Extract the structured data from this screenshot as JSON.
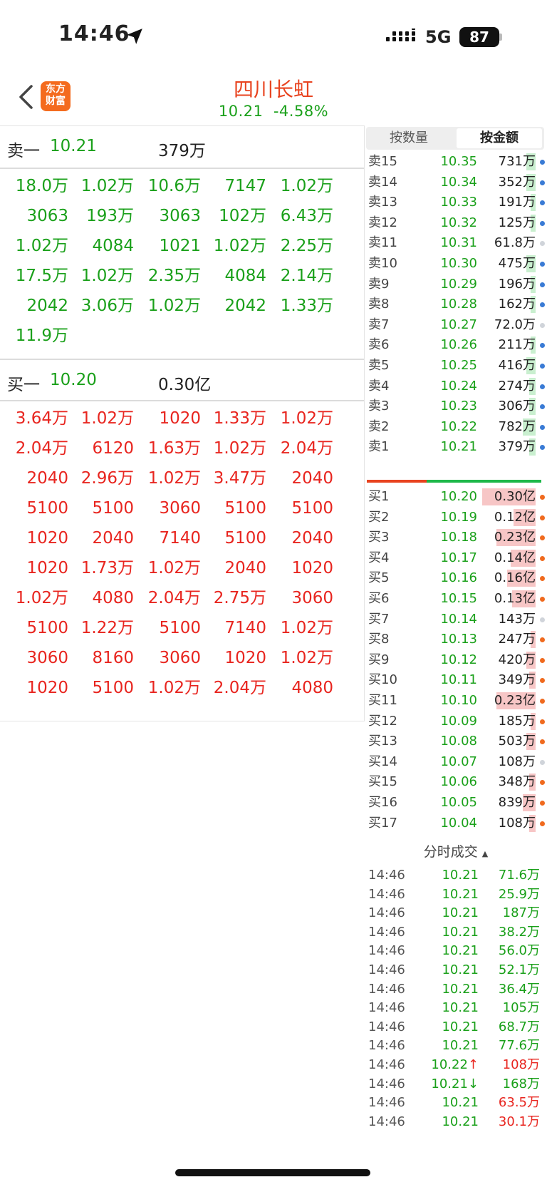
{
  "status": {
    "time": "14:46",
    "network": "5G",
    "battery": "87"
  },
  "header": {
    "logo_line1": "东方",
    "logo_line2": "财富",
    "title": "四川长虹",
    "price": "10.21",
    "change": "-4.58%"
  },
  "sell1": {
    "label": "卖一",
    "price": "10.21",
    "volume": "379万"
  },
  "sell1_orders": [
    "18.0万",
    "1.02万",
    "10.6万",
    "7147",
    "1.02万",
    "3063",
    "193万",
    "3063",
    "102万",
    "6.43万",
    "1.02万",
    "4084",
    "1021",
    "1.02万",
    "2.25万",
    "17.5万",
    "1.02万",
    "2.35万",
    "4084",
    "2.14万",
    "2042",
    "3.06万",
    "1.02万",
    "2042",
    "1.33万",
    "11.9万"
  ],
  "buy1": {
    "label": "买一",
    "price": "10.20",
    "volume": "0.30亿"
  },
  "buy1_orders": [
    "3.64万",
    "1.02万",
    "1020",
    "1.33万",
    "1.02万",
    "2.04万",
    "6120",
    "1.63万",
    "1.02万",
    "2.04万",
    "2040",
    "2.96万",
    "1.02万",
    "3.47万",
    "2040",
    "5100",
    "5100",
    "3060",
    "5100",
    "5100",
    "1020",
    "2040",
    "7140",
    "5100",
    "2040",
    "1020",
    "1.73万",
    "1.02万",
    "2040",
    "1020",
    "1.02万",
    "4080",
    "2.04万",
    "2.75万",
    "3060",
    "5100",
    "1.22万",
    "5100",
    "7140",
    "1.02万",
    "3060",
    "8160",
    "3060",
    "1020",
    "1.02万",
    "1020",
    "5100",
    "1.02万",
    "2.04万",
    "4080"
  ],
  "tabs": [
    "按数量",
    "按金额"
  ],
  "asks": [
    {
      "name": "卖15",
      "price": "10.35",
      "amount": "731万",
      "fill": 0.15,
      "dot": "#3a7bd5"
    },
    {
      "name": "卖14",
      "price": "10.34",
      "amount": "352万",
      "fill": 0.15,
      "dot": "#3a7bd5"
    },
    {
      "name": "卖13",
      "price": "10.33",
      "amount": "191万",
      "fill": 0.08,
      "dot": "#3a7bd5"
    },
    {
      "name": "卖12",
      "price": "10.32",
      "amount": "125万",
      "fill": 0.08,
      "dot": "#3a7bd5"
    },
    {
      "name": "卖11",
      "price": "10.31",
      "amount": "61.8万",
      "fill": 0,
      "dot": "#d0d4da"
    },
    {
      "name": "卖10",
      "price": "10.30",
      "amount": "475万",
      "fill": 0.15,
      "dot": "#3a7bd5"
    },
    {
      "name": "卖9",
      "price": "10.29",
      "amount": "196万",
      "fill": 0.08,
      "dot": "#3a7bd5"
    },
    {
      "name": "卖8",
      "price": "10.28",
      "amount": "162万",
      "fill": 0.08,
      "dot": "#3a7bd5"
    },
    {
      "name": "卖7",
      "price": "10.27",
      "amount": "72.0万",
      "fill": 0,
      "dot": "#d0d4da"
    },
    {
      "name": "卖6",
      "price": "10.26",
      "amount": "211万",
      "fill": 0.08,
      "dot": "#3a7bd5"
    },
    {
      "name": "卖5",
      "price": "10.25",
      "amount": "416万",
      "fill": 0.15,
      "dot": "#3a7bd5"
    },
    {
      "name": "卖4",
      "price": "10.24",
      "amount": "274万",
      "fill": 0.1,
      "dot": "#3a7bd5"
    },
    {
      "name": "卖3",
      "price": "10.23",
      "amount": "306万",
      "fill": 0.1,
      "dot": "#3a7bd5"
    },
    {
      "name": "卖2",
      "price": "10.22",
      "amount": "782万",
      "fill": 0.2,
      "dot": "#3a7bd5"
    },
    {
      "name": "卖1",
      "price": "10.21",
      "amount": "379万",
      "fill": 0.1,
      "dot": "#3a7bd5"
    }
  ],
  "bids": [
    {
      "name": "买1",
      "price": "10.20",
      "amount": "0.30亿",
      "fill": 0.85,
      "dot": "#f06a1e"
    },
    {
      "name": "买2",
      "price": "10.19",
      "amount": "0.12亿",
      "fill": 0.35,
      "dot": "#f06a1e"
    },
    {
      "name": "买3",
      "price": "10.18",
      "amount": "0.23亿",
      "fill": 0.62,
      "dot": "#f06a1e"
    },
    {
      "name": "买4",
      "price": "10.17",
      "amount": "0.14亿",
      "fill": 0.4,
      "dot": "#f06a1e"
    },
    {
      "name": "买5",
      "price": "10.16",
      "amount": "0.16亿",
      "fill": 0.45,
      "dot": "#f06a1e"
    },
    {
      "name": "买6",
      "price": "10.15",
      "amount": "0.13亿",
      "fill": 0.38,
      "dot": "#f06a1e"
    },
    {
      "name": "买7",
      "price": "10.14",
      "amount": "143万",
      "fill": 0,
      "dot": "#d0d4da"
    },
    {
      "name": "买8",
      "price": "10.13",
      "amount": "247万",
      "fill": 0.08,
      "dot": "#f06a1e"
    },
    {
      "name": "买9",
      "price": "10.12",
      "amount": "420万",
      "fill": 0.15,
      "dot": "#f06a1e"
    },
    {
      "name": "买10",
      "price": "10.11",
      "amount": "349万",
      "fill": 0.1,
      "dot": "#f06a1e"
    },
    {
      "name": "买11",
      "price": "10.10",
      "amount": "0.23亿",
      "fill": 0.62,
      "dot": "#f06a1e"
    },
    {
      "name": "买12",
      "price": "10.09",
      "amount": "185万",
      "fill": 0.08,
      "dot": "#f06a1e"
    },
    {
      "name": "买13",
      "price": "10.08",
      "amount": "503万",
      "fill": 0.15,
      "dot": "#f06a1e"
    },
    {
      "name": "买14",
      "price": "10.07",
      "amount": "108万",
      "fill": 0,
      "dot": "#d0d4da"
    },
    {
      "name": "买15",
      "price": "10.06",
      "amount": "348万",
      "fill": 0.1,
      "dot": "#f06a1e"
    },
    {
      "name": "买16",
      "price": "10.05",
      "amount": "839万",
      "fill": 0.2,
      "dot": "#f06a1e"
    },
    {
      "name": "买17",
      "price": "10.04",
      "amount": "108万",
      "fill": 0.1,
      "dot": "#f06a1e"
    }
  ],
  "ticks_title": "分时成交",
  "ticks": [
    {
      "time": "14:46",
      "price": "10.21",
      "amount": "71.6万",
      "color": "#1aa01a",
      "arrow": ""
    },
    {
      "time": "14:46",
      "price": "10.21",
      "amount": "25.9万",
      "color": "#1aa01a",
      "arrow": ""
    },
    {
      "time": "14:46",
      "price": "10.21",
      "amount": "187万",
      "color": "#1aa01a",
      "arrow": ""
    },
    {
      "time": "14:46",
      "price": "10.21",
      "amount": "38.2万",
      "color": "#1aa01a",
      "arrow": ""
    },
    {
      "time": "14:46",
      "price": "10.21",
      "amount": "56.0万",
      "color": "#1aa01a",
      "arrow": ""
    },
    {
      "time": "14:46",
      "price": "10.21",
      "amount": "52.1万",
      "color": "#1aa01a",
      "arrow": ""
    },
    {
      "time": "14:46",
      "price": "10.21",
      "amount": "36.4万",
      "color": "#1aa01a",
      "arrow": ""
    },
    {
      "time": "14:46",
      "price": "10.21",
      "amount": "105万",
      "color": "#1aa01a",
      "arrow": ""
    },
    {
      "time": "14:46",
      "price": "10.21",
      "amount": "68.7万",
      "color": "#1aa01a",
      "arrow": ""
    },
    {
      "time": "14:46",
      "price": "10.21",
      "amount": "77.6万",
      "color": "#1aa01a",
      "arrow": ""
    },
    {
      "time": "14:46",
      "price": "10.22",
      "amount": "108万",
      "color": "#e8251f",
      "arrow": "↑"
    },
    {
      "time": "14:46",
      "price": "10.21",
      "amount": "168万",
      "color": "#1aa01a",
      "arrow": "↓"
    },
    {
      "time": "14:46",
      "price": "10.21",
      "amount": "63.5万",
      "color": "#e8251f",
      "arrow": ""
    },
    {
      "time": "14:46",
      "price": "10.21",
      "amount": "30.1万",
      "color": "#e8251f",
      "arrow": ""
    }
  ]
}
